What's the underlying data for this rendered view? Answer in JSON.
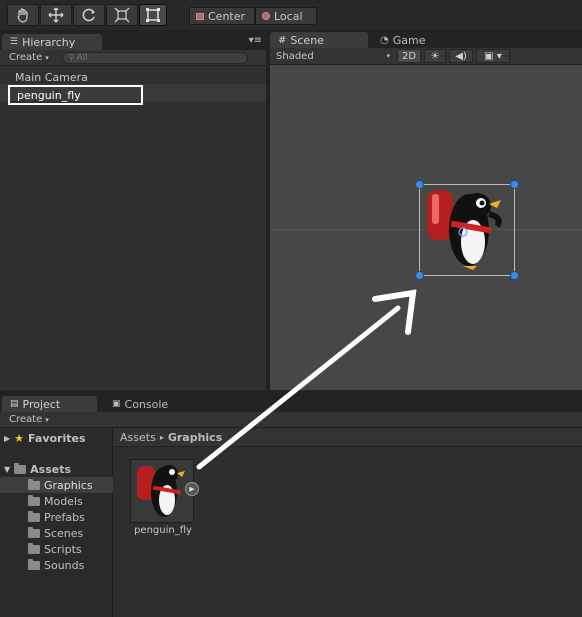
{
  "toolbar": {
    "tools": [
      "hand-icon",
      "move-icon",
      "rotate-icon",
      "scale-icon",
      "rect-icon"
    ],
    "pivot_label": "Center",
    "space_label": "Local"
  },
  "hierarchy": {
    "tab_label": "Hierarchy",
    "create_label": "Create",
    "search_placeholder": "All",
    "items": [
      "Main Camera",
      "penguin_fly"
    ]
  },
  "scene": {
    "tab_label": "Scene",
    "game_tab_label": "Game",
    "shading_mode": "Shaded",
    "mode_2d_label": "2D"
  },
  "project": {
    "tab_label": "Project",
    "console_tab_label": "Console",
    "create_label": "Create",
    "favorites_label": "Favorites",
    "assets_label": "Assets",
    "folders": [
      "Graphics",
      "Models",
      "Prefabs",
      "Scenes",
      "Scripts",
      "Sounds"
    ],
    "breadcrumb_root": "Assets",
    "breadcrumb_current": "Graphics",
    "asset_name": "penguin_fly"
  },
  "colors": {
    "panel": "#303030",
    "selection_box": "#ffffff",
    "handle_blue": "#3f8de0"
  }
}
